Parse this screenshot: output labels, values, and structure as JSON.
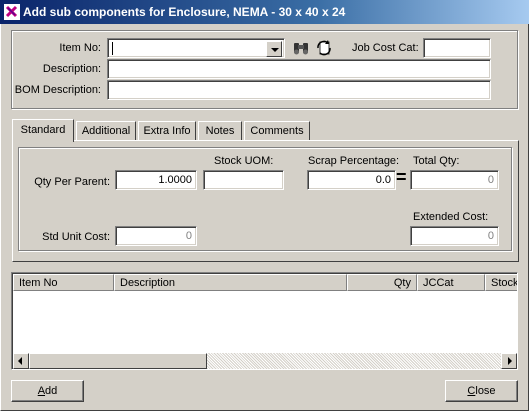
{
  "window": {
    "title": "Add sub components for Enclosure, NEMA - 30 x 40 x 24"
  },
  "header": {
    "item_no_label": "Item No:",
    "item_no_value": "",
    "job_cost_cat_label": "Job Cost Cat:",
    "job_cost_cat_value": "",
    "description_label": "Description:",
    "description_value": "",
    "bom_description_label": "BOM Description:",
    "bom_description_value": "",
    "icons": [
      "binoculars-icon",
      "refresh-icon"
    ]
  },
  "tabs": [
    {
      "label": "Standard",
      "active": true
    },
    {
      "label": "Additional",
      "active": false
    },
    {
      "label": "Extra Info",
      "active": false
    },
    {
      "label": "Notes",
      "active": false
    },
    {
      "label": "Comments",
      "active": false
    }
  ],
  "standard": {
    "qty_per_parent_label": "Qty Per Parent:",
    "qty_per_parent_value": "1.0000",
    "stock_uom_label": "Stock UOM:",
    "stock_uom_value": "",
    "scrap_percentage_label": "Scrap Percentage:",
    "scrap_percentage_value": "0.0",
    "equals_sign": "=",
    "total_qty_label": "Total Qty:",
    "total_qty_value": "0",
    "std_unit_cost_label": "Std Unit Cost:",
    "std_unit_cost_value": "0",
    "extended_cost_label": "Extended Cost:",
    "extended_cost_value": "0"
  },
  "grid": {
    "columns": [
      "Item No",
      "Description",
      "Qty",
      "JCCat",
      "Stock"
    ],
    "rows": []
  },
  "buttons": {
    "add": {
      "mnemonic": "A",
      "rest": "dd"
    },
    "close": {
      "mnemonic": "C",
      "rest": "lose"
    }
  },
  "colors": {
    "titlebar_start": "#0a246a",
    "titlebar_end": "#a6caf0",
    "face": "#d4d0c8"
  }
}
